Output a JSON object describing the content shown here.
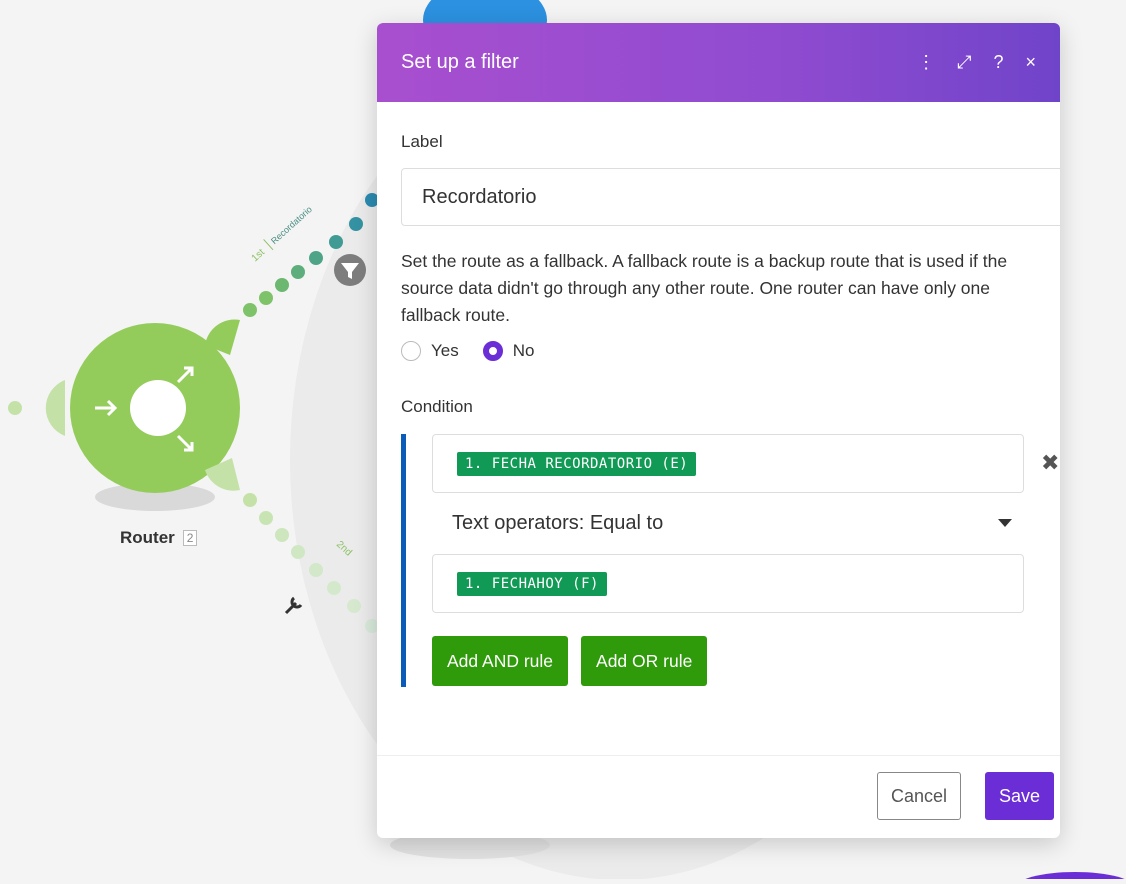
{
  "canvas": {
    "router_label": "Router",
    "router_badge": "2",
    "route_1_label": "1st",
    "route_1_name": "Recordatorio",
    "route_2_label": "2nd"
  },
  "dialog": {
    "title": "Set up a filter",
    "header_icons": [
      "more-icon",
      "expand-icon",
      "help-icon",
      "close-icon"
    ],
    "label_field_label": "Label",
    "label_value": "Recordatorio",
    "fallback_help": "Set the route as a fallback. A fallback route is a backup route that is used if the source data didn't go through any other route. One router can have only one fallback route.",
    "fallback_yes": "Yes",
    "fallback_no": "No",
    "fallback_selected": "No",
    "condition_label": "Condition",
    "condition": {
      "left_operand": "1. FECHA RECORDATORIO (E)",
      "operator": "Text operators: Equal to",
      "right_operand": "1. FECHAHOY (F)"
    },
    "add_and": "Add AND rule",
    "add_or": "Add OR rule",
    "cancel": "Cancel",
    "save": "Save"
  },
  "colors": {
    "header_gradient_start": "#a84fcf",
    "header_gradient_end": "#7044c9",
    "primary": "#6b2ed6",
    "green_button": "#2f9a0a",
    "pill": "#119a55",
    "router_green": "#94cc5c",
    "condition_bar": "#0a5cb8"
  }
}
